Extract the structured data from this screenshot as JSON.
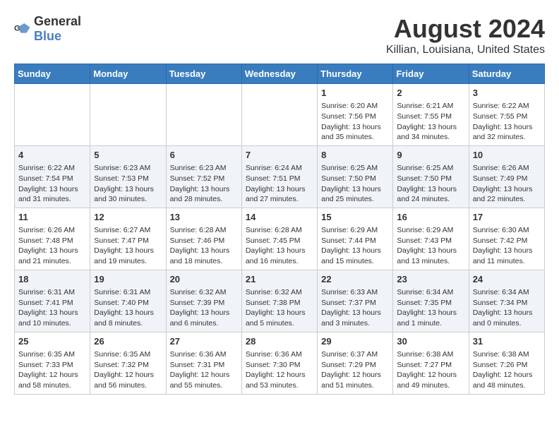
{
  "header": {
    "logo_general": "General",
    "logo_blue": "Blue",
    "month": "August 2024",
    "location": "Killian, Louisiana, United States"
  },
  "days_of_week": [
    "Sunday",
    "Monday",
    "Tuesday",
    "Wednesday",
    "Thursday",
    "Friday",
    "Saturday"
  ],
  "weeks": [
    [
      {
        "day": "",
        "info": ""
      },
      {
        "day": "",
        "info": ""
      },
      {
        "day": "",
        "info": ""
      },
      {
        "day": "",
        "info": ""
      },
      {
        "day": "1",
        "info": "Sunrise: 6:20 AM\nSunset: 7:56 PM\nDaylight: 13 hours\nand 35 minutes."
      },
      {
        "day": "2",
        "info": "Sunrise: 6:21 AM\nSunset: 7:55 PM\nDaylight: 13 hours\nand 34 minutes."
      },
      {
        "day": "3",
        "info": "Sunrise: 6:22 AM\nSunset: 7:55 PM\nDaylight: 13 hours\nand 32 minutes."
      }
    ],
    [
      {
        "day": "4",
        "info": "Sunrise: 6:22 AM\nSunset: 7:54 PM\nDaylight: 13 hours\nand 31 minutes."
      },
      {
        "day": "5",
        "info": "Sunrise: 6:23 AM\nSunset: 7:53 PM\nDaylight: 13 hours\nand 30 minutes."
      },
      {
        "day": "6",
        "info": "Sunrise: 6:23 AM\nSunset: 7:52 PM\nDaylight: 13 hours\nand 28 minutes."
      },
      {
        "day": "7",
        "info": "Sunrise: 6:24 AM\nSunset: 7:51 PM\nDaylight: 13 hours\nand 27 minutes."
      },
      {
        "day": "8",
        "info": "Sunrise: 6:25 AM\nSunset: 7:50 PM\nDaylight: 13 hours\nand 25 minutes."
      },
      {
        "day": "9",
        "info": "Sunrise: 6:25 AM\nSunset: 7:50 PM\nDaylight: 13 hours\nand 24 minutes."
      },
      {
        "day": "10",
        "info": "Sunrise: 6:26 AM\nSunset: 7:49 PM\nDaylight: 13 hours\nand 22 minutes."
      }
    ],
    [
      {
        "day": "11",
        "info": "Sunrise: 6:26 AM\nSunset: 7:48 PM\nDaylight: 13 hours\nand 21 minutes."
      },
      {
        "day": "12",
        "info": "Sunrise: 6:27 AM\nSunset: 7:47 PM\nDaylight: 13 hours\nand 19 minutes."
      },
      {
        "day": "13",
        "info": "Sunrise: 6:28 AM\nSunset: 7:46 PM\nDaylight: 13 hours\nand 18 minutes."
      },
      {
        "day": "14",
        "info": "Sunrise: 6:28 AM\nSunset: 7:45 PM\nDaylight: 13 hours\nand 16 minutes."
      },
      {
        "day": "15",
        "info": "Sunrise: 6:29 AM\nSunset: 7:44 PM\nDaylight: 13 hours\nand 15 minutes."
      },
      {
        "day": "16",
        "info": "Sunrise: 6:29 AM\nSunset: 7:43 PM\nDaylight: 13 hours\nand 13 minutes."
      },
      {
        "day": "17",
        "info": "Sunrise: 6:30 AM\nSunset: 7:42 PM\nDaylight: 13 hours\nand 11 minutes."
      }
    ],
    [
      {
        "day": "18",
        "info": "Sunrise: 6:31 AM\nSunset: 7:41 PM\nDaylight: 13 hours\nand 10 minutes."
      },
      {
        "day": "19",
        "info": "Sunrise: 6:31 AM\nSunset: 7:40 PM\nDaylight: 13 hours\nand 8 minutes."
      },
      {
        "day": "20",
        "info": "Sunrise: 6:32 AM\nSunset: 7:39 PM\nDaylight: 13 hours\nand 6 minutes."
      },
      {
        "day": "21",
        "info": "Sunrise: 6:32 AM\nSunset: 7:38 PM\nDaylight: 13 hours\nand 5 minutes."
      },
      {
        "day": "22",
        "info": "Sunrise: 6:33 AM\nSunset: 7:37 PM\nDaylight: 13 hours\nand 3 minutes."
      },
      {
        "day": "23",
        "info": "Sunrise: 6:34 AM\nSunset: 7:35 PM\nDaylight: 13 hours\nand 1 minute."
      },
      {
        "day": "24",
        "info": "Sunrise: 6:34 AM\nSunset: 7:34 PM\nDaylight: 13 hours\nand 0 minutes."
      }
    ],
    [
      {
        "day": "25",
        "info": "Sunrise: 6:35 AM\nSunset: 7:33 PM\nDaylight: 12 hours\nand 58 minutes."
      },
      {
        "day": "26",
        "info": "Sunrise: 6:35 AM\nSunset: 7:32 PM\nDaylight: 12 hours\nand 56 minutes."
      },
      {
        "day": "27",
        "info": "Sunrise: 6:36 AM\nSunset: 7:31 PM\nDaylight: 12 hours\nand 55 minutes."
      },
      {
        "day": "28",
        "info": "Sunrise: 6:36 AM\nSunset: 7:30 PM\nDaylight: 12 hours\nand 53 minutes."
      },
      {
        "day": "29",
        "info": "Sunrise: 6:37 AM\nSunset: 7:29 PM\nDaylight: 12 hours\nand 51 minutes."
      },
      {
        "day": "30",
        "info": "Sunrise: 6:38 AM\nSunset: 7:27 PM\nDaylight: 12 hours\nand 49 minutes."
      },
      {
        "day": "31",
        "info": "Sunrise: 6:38 AM\nSunset: 7:26 PM\nDaylight: 12 hours\nand 48 minutes."
      }
    ]
  ]
}
